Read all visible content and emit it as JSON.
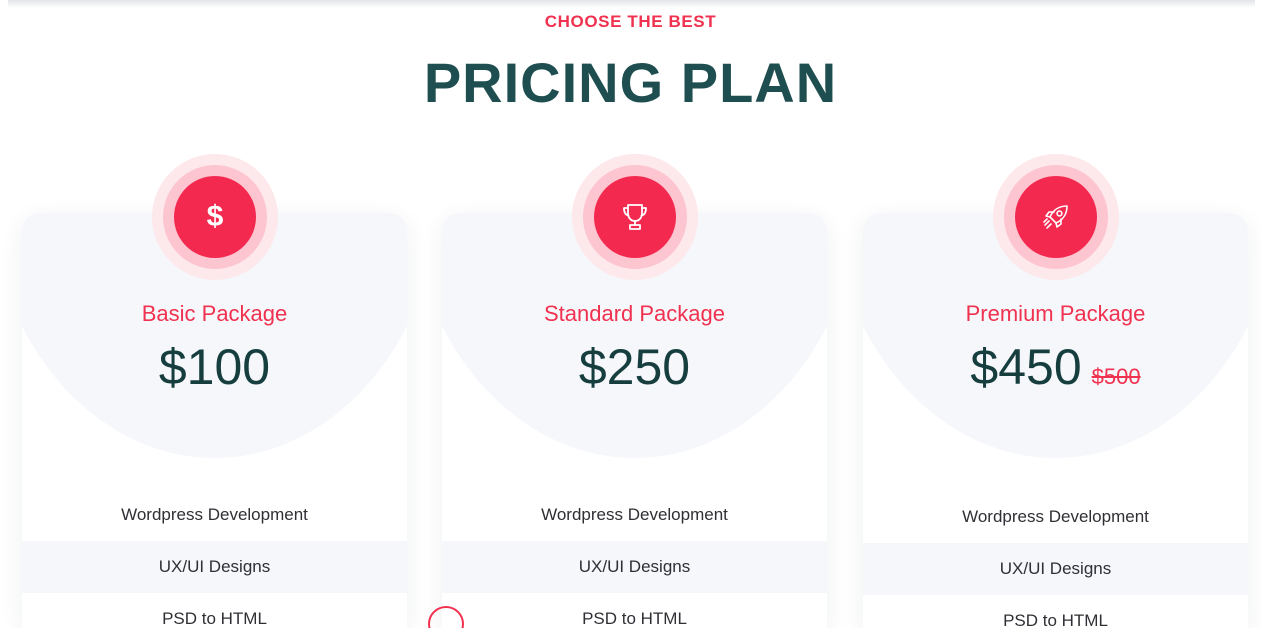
{
  "section": {
    "eyebrow": "CHOOSE THE BEST",
    "title": "PRICING PLAN"
  },
  "colors": {
    "accent": "#f0314f",
    "heading": "#1f4e50",
    "price": "#173e3e",
    "panel": "#f5f7fb"
  },
  "plans": [
    {
      "icon": "dollar-icon",
      "name": "Basic Package",
      "price": "$100",
      "old_price": "",
      "features": [
        "Wordpress Development",
        "UX/UI Designs",
        "PSD to HTML"
      ]
    },
    {
      "icon": "trophy-icon",
      "name": "Standard Package",
      "price": "$250",
      "old_price": "",
      "features": [
        "Wordpress Development",
        "UX/UI Designs",
        "PSD to HTML"
      ]
    },
    {
      "icon": "rocket-icon",
      "name": "Premium Package",
      "price": "$450",
      "old_price": "$500",
      "features": [
        "Wordpress Development",
        "UX/UI Designs",
        "PSD to HTML"
      ]
    }
  ],
  "icons": {
    "dollar_glyph": "$"
  }
}
